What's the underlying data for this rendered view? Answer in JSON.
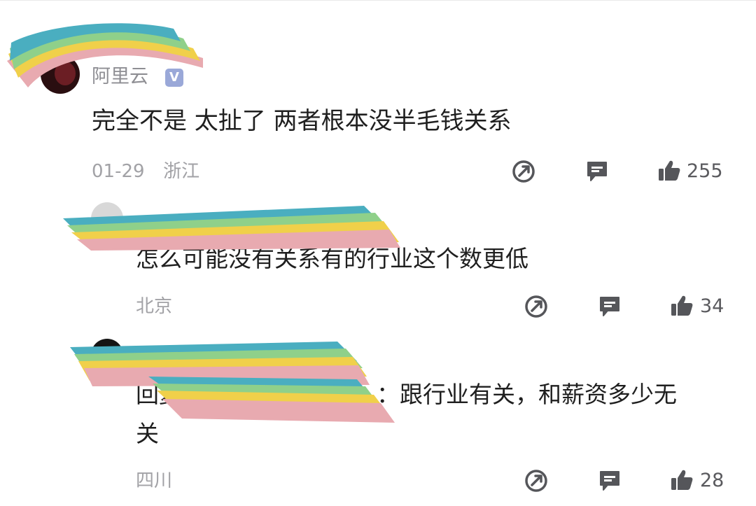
{
  "comments": [
    {
      "username": "阿里云",
      "verified_badge": "V",
      "text": "完全不是 太扯了 两者根本没半毛钱关系",
      "date": "01-29",
      "location": "浙江",
      "likes": "255",
      "icons": [
        "share-icon",
        "reply-icon",
        "like-icon"
      ]
    },
    {
      "text": "怎么可能没有关系有的行业这个数更低",
      "location": "北京",
      "likes": "34",
      "icons": [
        "share-icon",
        "reply-icon",
        "like-icon"
      ]
    },
    {
      "reply_prefix": "回复",
      "text_line1": "：跟行业有关，和薪资多少无",
      "text_line2": "关",
      "location": "四川",
      "likes": "28",
      "icons": [
        "share-icon",
        "reply-icon",
        "like-icon"
      ]
    }
  ],
  "colors": {
    "text_primary": "#1f1f1f",
    "text_meta": "#a2a2a6",
    "icon": "#55565a",
    "verified_badge": "#9aa8d8",
    "redaction_bands": [
      "#e8aab0",
      "#f0d04a",
      "#8fd08a",
      "#4aaec0"
    ]
  }
}
